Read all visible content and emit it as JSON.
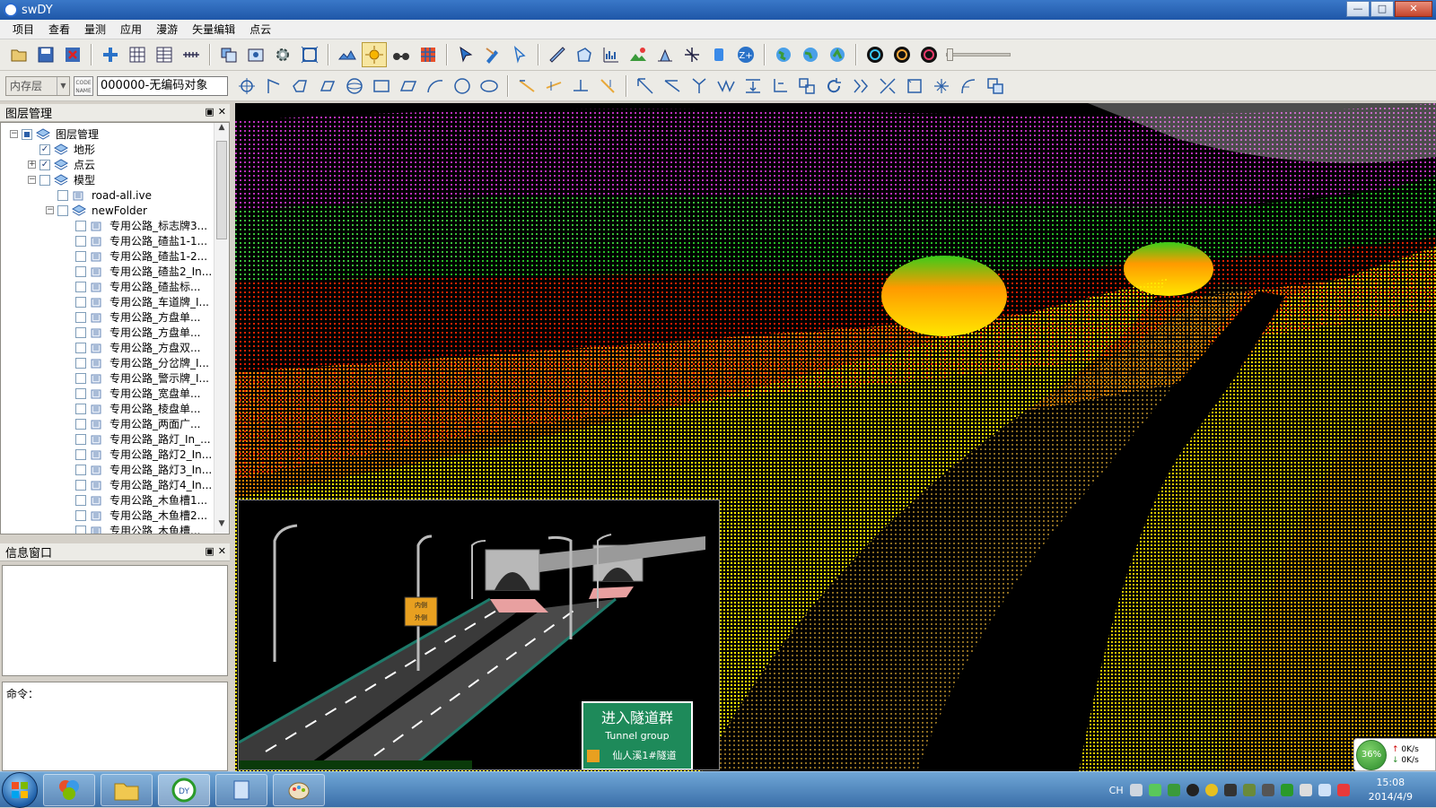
{
  "window": {
    "title": "swDY",
    "controls": [
      "—",
      "□",
      "✕"
    ]
  },
  "menu": {
    "items": [
      "项目",
      "查看",
      "量测",
      "应用",
      "漫游",
      "矢量编辑",
      "点云"
    ]
  },
  "toolbar2": {
    "layer_select": "内存层",
    "code_name": "CODE NAME",
    "code_value": "000000-无编码对象"
  },
  "layer_panel": {
    "title": "图层管理",
    "tree": [
      {
        "label": "图层管理",
        "level": 0,
        "expander": "−",
        "check": "partial",
        "icon": "layer"
      },
      {
        "label": "地形",
        "level": 1,
        "expander": "",
        "check": "checked",
        "icon": "layer"
      },
      {
        "label": "点云",
        "level": 1,
        "expander": "+",
        "check": "checked",
        "icon": "layer"
      },
      {
        "label": "模型",
        "level": 1,
        "expander": "−",
        "check": "none",
        "icon": "layer"
      },
      {
        "label": "road-all.ive",
        "level": 2,
        "expander": "",
        "check": "none",
        "icon": "model"
      },
      {
        "label": "newFolder",
        "level": 2,
        "expander": "−",
        "check": "none",
        "icon": "layer"
      },
      {
        "label": "专用公路_标志牌3...",
        "level": 3,
        "expander": "",
        "check": "none",
        "icon": "model"
      },
      {
        "label": "专用公路_碴盐1-1...",
        "level": 3,
        "expander": "",
        "check": "none",
        "icon": "model"
      },
      {
        "label": "专用公路_碴盐1-2...",
        "level": 3,
        "expander": "",
        "check": "none",
        "icon": "model"
      },
      {
        "label": "专用公路_碴盐2_In...",
        "level": 3,
        "expander": "",
        "check": "none",
        "icon": "model"
      },
      {
        "label": "专用公路_碴盐标...",
        "level": 3,
        "expander": "",
        "check": "none",
        "icon": "model"
      },
      {
        "label": "专用公路_车道牌_I...",
        "level": 3,
        "expander": "",
        "check": "none",
        "icon": "model"
      },
      {
        "label": "专用公路_方盘单...",
        "level": 3,
        "expander": "",
        "check": "none",
        "icon": "model"
      },
      {
        "label": "专用公路_方盘单...",
        "level": 3,
        "expander": "",
        "check": "none",
        "icon": "model"
      },
      {
        "label": "专用公路_方盘双...",
        "level": 3,
        "expander": "",
        "check": "none",
        "icon": "model"
      },
      {
        "label": "专用公路_分岔牌_I...",
        "level": 3,
        "expander": "",
        "check": "none",
        "icon": "model"
      },
      {
        "label": "专用公路_警示牌_I...",
        "level": 3,
        "expander": "",
        "check": "none",
        "icon": "model"
      },
      {
        "label": "专用公路_宽盘单...",
        "level": 3,
        "expander": "",
        "check": "none",
        "icon": "model"
      },
      {
        "label": "专用公路_棱盘单...",
        "level": 3,
        "expander": "",
        "check": "none",
        "icon": "model"
      },
      {
        "label": "专用公路_两面广...",
        "level": 3,
        "expander": "",
        "check": "none",
        "icon": "model"
      },
      {
        "label": "专用公路_路灯_In_...",
        "level": 3,
        "expander": "",
        "check": "none",
        "icon": "model"
      },
      {
        "label": "专用公路_路灯2_In...",
        "level": 3,
        "expander": "",
        "check": "none",
        "icon": "model"
      },
      {
        "label": "专用公路_路灯3_In...",
        "level": 3,
        "expander": "",
        "check": "none",
        "icon": "model"
      },
      {
        "label": "专用公路_路灯4_In...",
        "level": 3,
        "expander": "",
        "check": "none",
        "icon": "model"
      },
      {
        "label": "专用公路_木鱼槽1...",
        "level": 3,
        "expander": "",
        "check": "none",
        "icon": "model"
      },
      {
        "label": "专用公路_木鱼槽2...",
        "level": 3,
        "expander": "",
        "check": "none",
        "icon": "model"
      },
      {
        "label": "专用公路_木鱼槽...",
        "level": 3,
        "expander": "",
        "check": "none",
        "icon": "model"
      }
    ]
  },
  "info_panel": {
    "title": "信息窗口"
  },
  "command": {
    "label": "命令："
  },
  "inset_view": {
    "sign_line1": "进入隧道群",
    "sign_line2": "Tunnel group",
    "sign_line3": "仙人溪1#隧道",
    "small_sign_1": "内侧",
    "small_sign_2": "外侧"
  },
  "net_speed": {
    "percent": "36%",
    "up": "0K/s",
    "down": "0K/s"
  },
  "taskbar": {
    "lang": "CH",
    "time": "15:08",
    "date": "2014/4/9"
  },
  "colors": {
    "title_blue": "#1f57a8",
    "taskbar_blue": "#3a6ea8",
    "point_yellow": "#ffe600",
    "point_magenta": "#cc33cc"
  }
}
